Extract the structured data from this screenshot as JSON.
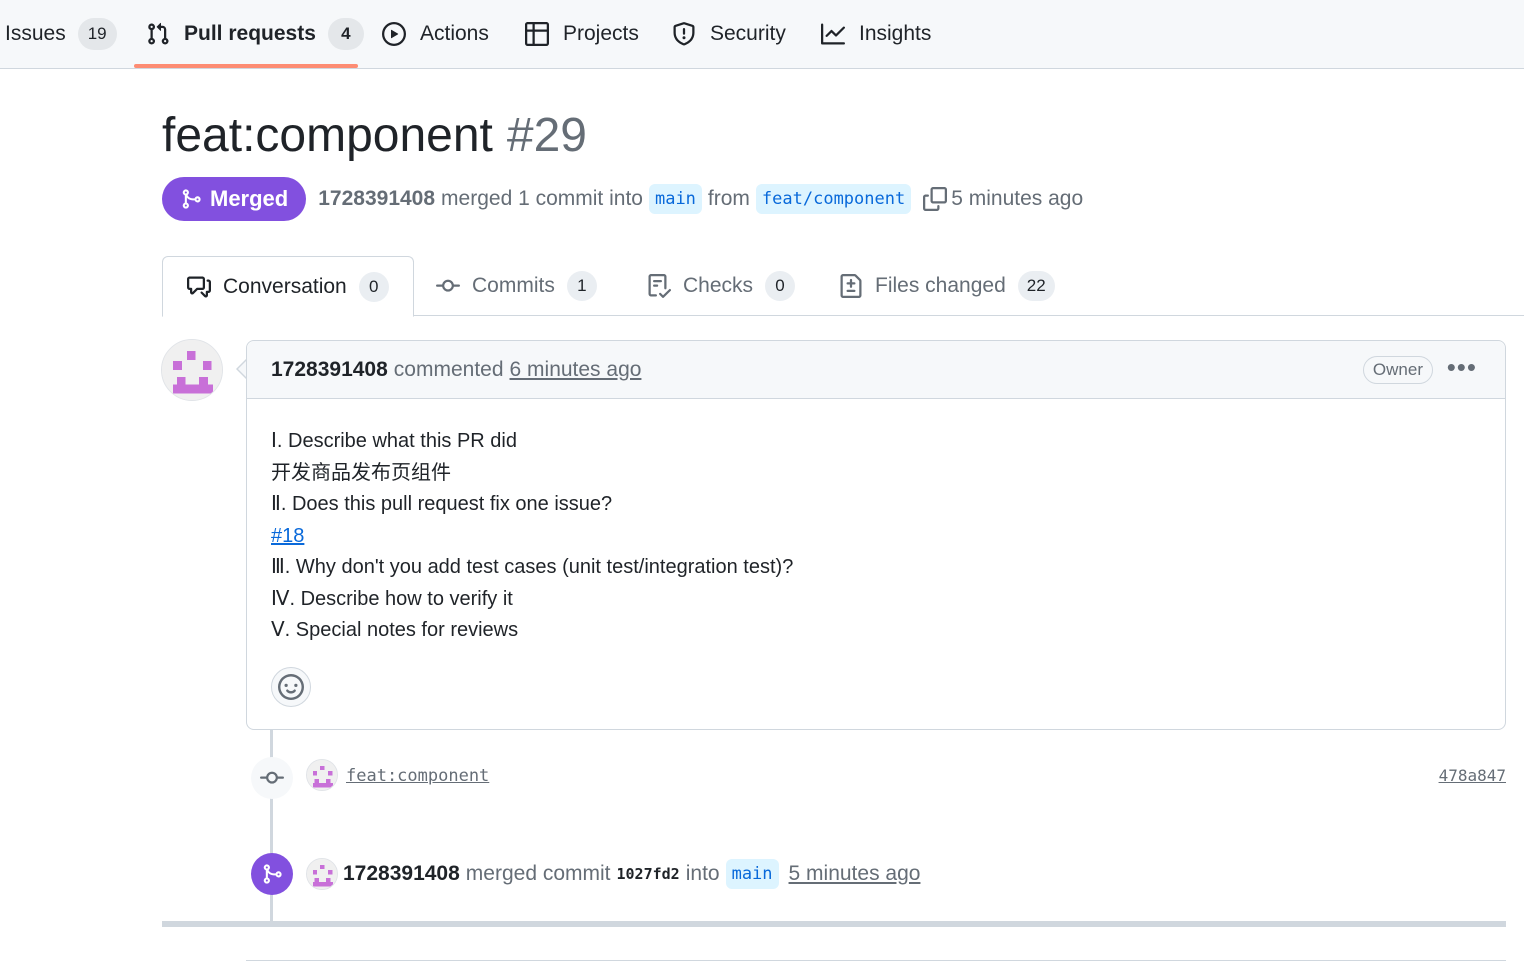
{
  "repo_nav": {
    "issues": {
      "label": "Issues",
      "count": "19"
    },
    "pull_requests": {
      "label": "Pull requests",
      "count": "4"
    },
    "actions": {
      "label": "Actions"
    },
    "projects": {
      "label": "Projects"
    },
    "security": {
      "label": "Security"
    },
    "insights": {
      "label": "Insights"
    }
  },
  "pr": {
    "title": "feat:component",
    "number": "#29",
    "state": "Merged",
    "author": "1728391408",
    "merge_text": "merged 1 commit into",
    "base_branch": "main",
    "from_text": "from",
    "head_branch": "feat/component",
    "time": "5 minutes ago"
  },
  "tabs": [
    {
      "label": "Conversation",
      "count": "0"
    },
    {
      "label": "Commits",
      "count": "1"
    },
    {
      "label": "Checks",
      "count": "0"
    },
    {
      "label": "Files changed",
      "count": "22"
    }
  ],
  "comment": {
    "author": "1728391408",
    "action": "commented",
    "time": "6 minutes ago",
    "role": "Owner",
    "lines": [
      "Ⅰ. Describe what this PR did",
      "开发商品发布页组件",
      "Ⅱ. Does this pull request fix one issue?",
      "#18",
      "Ⅲ. Why don't you add test cases (unit test/integration test)?",
      "Ⅳ. Describe how to verify it",
      "Ⅴ. Special notes for reviews"
    ]
  },
  "timeline": {
    "commit": {
      "message": "feat:component",
      "sha": "478a847"
    },
    "merge": {
      "author": "1728391408",
      "text": "merged commit",
      "sha": "1027fd2",
      "into": "into",
      "branch": "main",
      "time": "5 minutes ago"
    }
  },
  "colors": {
    "merged": "#8250df",
    "link": "#0969da",
    "nav_underline": "#fd8c73",
    "avatar": "#c870d8"
  }
}
